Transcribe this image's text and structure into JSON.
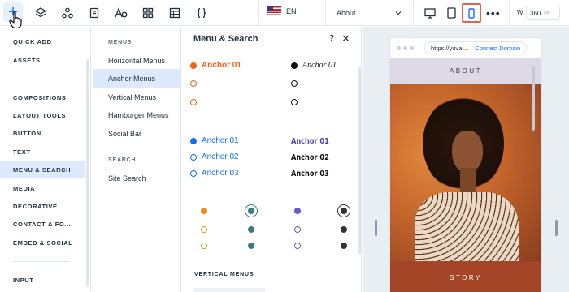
{
  "topbar": {
    "language": "EN",
    "page_selected": "About",
    "width_label": "W",
    "width_value": "360",
    "width_unit": "px",
    "more_label": "•••"
  },
  "leftnav": {
    "items": [
      {
        "label": "QUICK ADD"
      },
      {
        "label": "ASSETS"
      },
      {
        "label": "COMPOSITIONS"
      },
      {
        "label": "LAYOUT TOOLS"
      },
      {
        "label": "BUTTON"
      },
      {
        "label": "TEXT"
      },
      {
        "label": "MENU & SEARCH"
      },
      {
        "label": "MEDIA"
      },
      {
        "label": "DECORATIVE"
      },
      {
        "label": "CONTACT & FO..."
      },
      {
        "label": "EMBED & SOCIAL"
      },
      {
        "label": "INPUT"
      }
    ]
  },
  "categories": {
    "menus_heading": "MENUS",
    "menus": [
      "Horizontal Menus",
      "Anchor Menus",
      "Vertical Menus",
      "Hamburger Menus",
      "Social Bar"
    ],
    "search_heading": "SEARCH",
    "search": [
      "Site Search"
    ]
  },
  "panel": {
    "title": "Menu & Search",
    "help": "?",
    "close": "✕",
    "anchor_sets": {
      "orange": [
        "Anchor 01"
      ],
      "serif_italic": [
        "Anchor 01"
      ],
      "blue": [
        "Anchor 01",
        "Anchor 02",
        "Anchor 03"
      ],
      "bold_condensed": [
        "Anchor 01",
        "Anchor 02",
        "Anchor 03"
      ]
    },
    "vertical_menus_heading": "VERTICAL MENUS"
  },
  "preview": {
    "url": "https://yuval...",
    "connect_domain": "Connect Domain",
    "about": "ABOUT",
    "story": "STORY"
  },
  "colors": {
    "accent": "#116dff",
    "orange": "#f26419",
    "teal": "#3d7a85",
    "purple": "#6a5acd",
    "active_device": "#e8624a"
  }
}
